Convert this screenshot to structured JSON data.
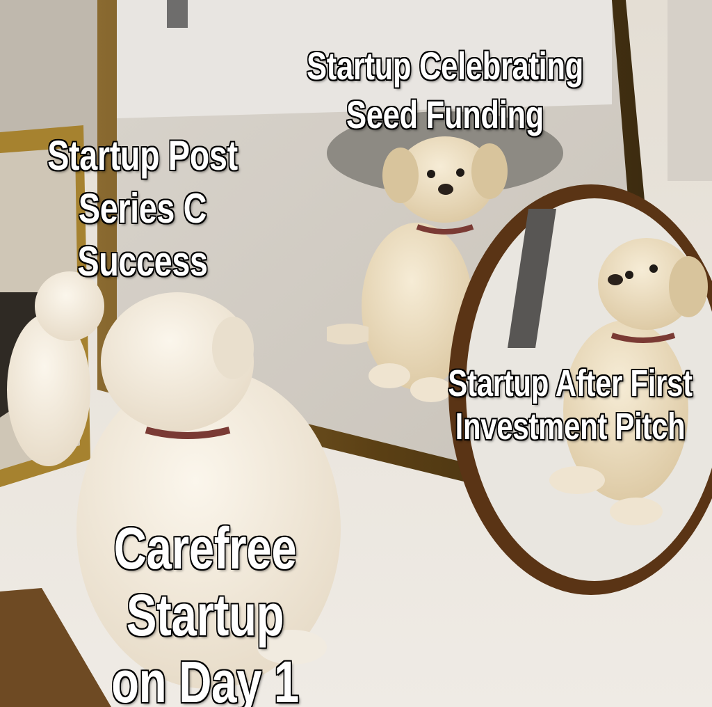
{
  "meme": {
    "captions": {
      "seed_funding": "Startup Celebrating\nSeed Funding",
      "series_c": "Startup Post\nSeries C\nSuccess",
      "first_pitch": "Startup After First\nInvestment Pitch",
      "day_one": "Carefree Startup\non Day 1"
    },
    "colors": {
      "caption_text": "#ffffff",
      "caption_outline": "#000000",
      "mirror_frame": "#6b4a1c",
      "round_mirror_rim": "#5a3415",
      "puppy_fur": "#f4ecdd",
      "collar": "#7a3a34"
    }
  }
}
